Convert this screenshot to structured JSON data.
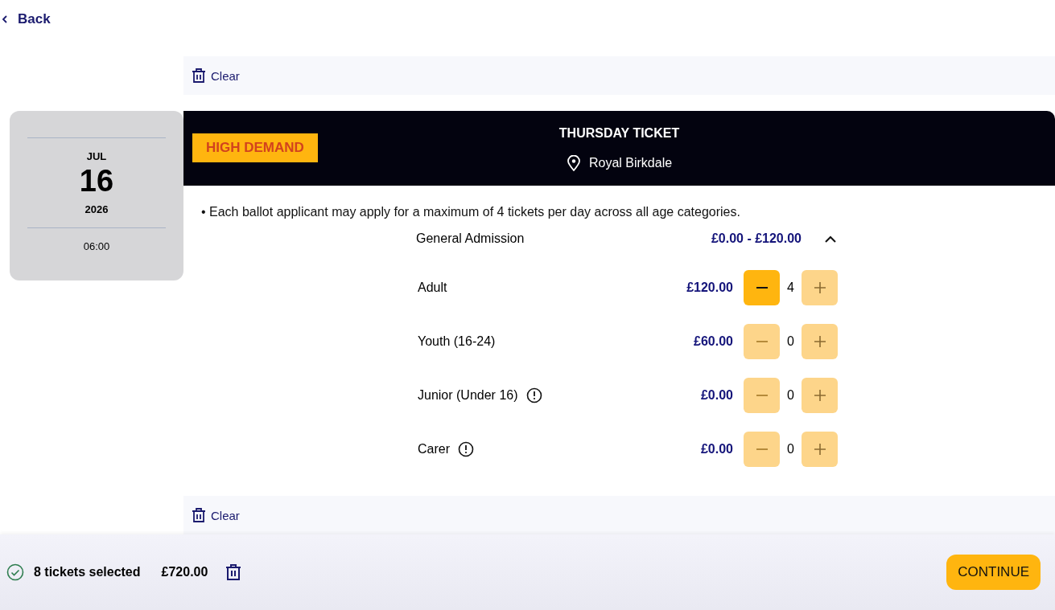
{
  "back": {
    "label": "Back"
  },
  "clear_top": {
    "label": "Clear"
  },
  "date_card": {
    "month": "JUL",
    "day": "16",
    "year": "2026",
    "time": "06:00"
  },
  "ticket": {
    "badge": "HIGH DEMAND",
    "title": "THURSDAY TICKET",
    "venue": "Royal Birkdale"
  },
  "note": "• Each ballot applicant may apply for a maximum of 4 tickets per day across all age categories.",
  "category": {
    "name": "General Admission",
    "price_range": "£0.00 - £120.00",
    "expanded": true
  },
  "rows": [
    {
      "label": "Adult",
      "info": false,
      "price": "£120.00",
      "count": "4",
      "minus_enabled": true
    },
    {
      "label": "Youth (16-24)",
      "info": false,
      "price": "£60.00",
      "count": "0",
      "minus_enabled": false
    },
    {
      "label": "Junior (Under 16)",
      "info": true,
      "price": "£0.00",
      "count": "0",
      "minus_enabled": false
    },
    {
      "label": "Carer",
      "info": true,
      "price": "£0.00",
      "count": "0",
      "minus_enabled": false
    }
  ],
  "clear_bottom": {
    "label": "Clear"
  },
  "footer": {
    "selected": "8 tickets selected",
    "total": "£720.00",
    "continue": "CONTINUE"
  }
}
